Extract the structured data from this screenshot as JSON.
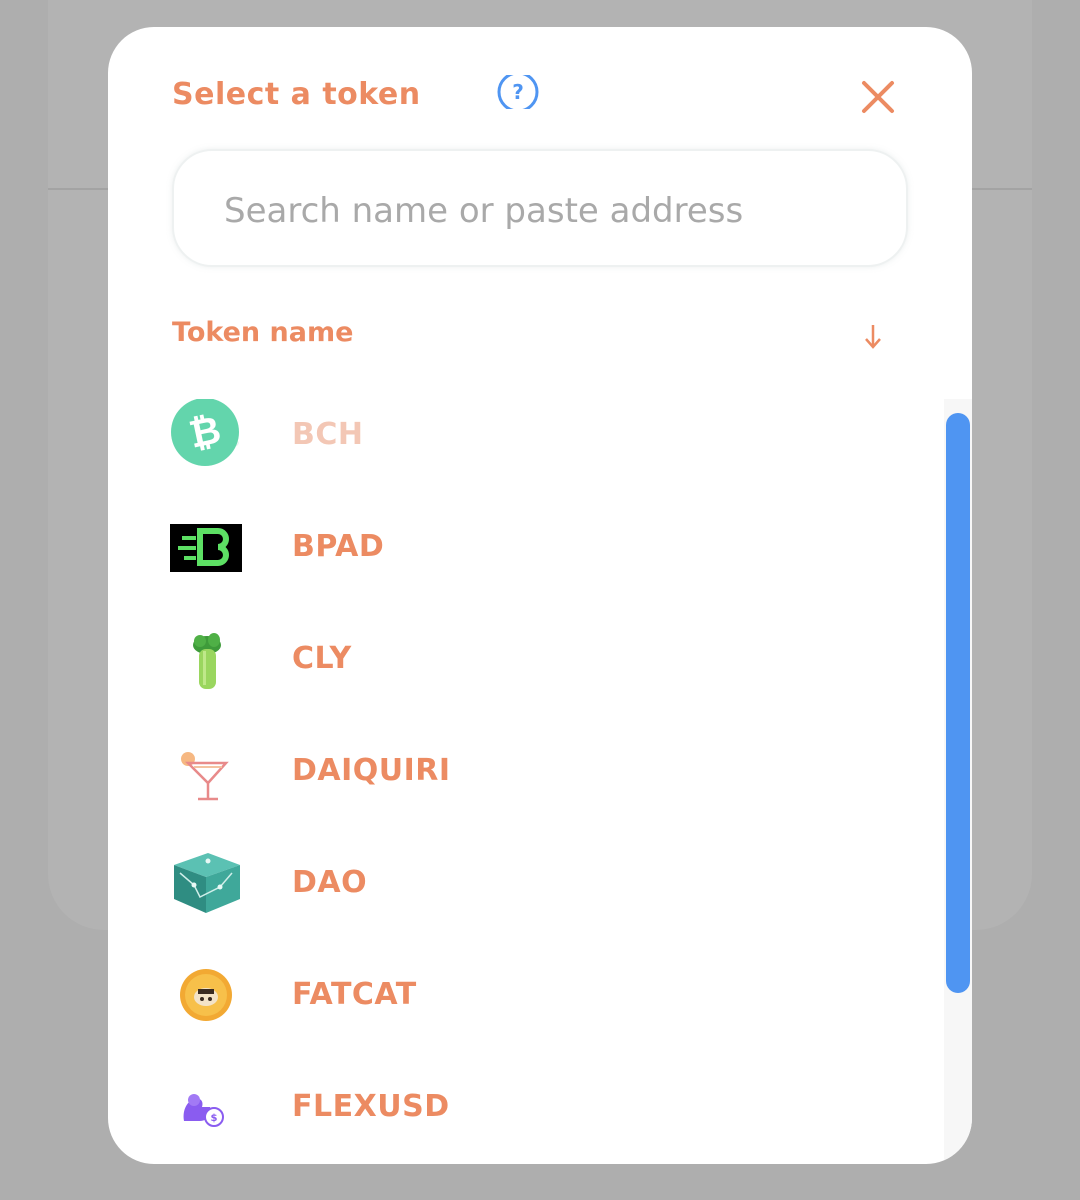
{
  "modal": {
    "title": "Select a token",
    "search_placeholder": "Search name or paste address",
    "list_header": "Token name",
    "accent_color": "#ec8b62",
    "scrollbar_color": "#4f95f2"
  },
  "tokens": [
    {
      "symbol": "BCH",
      "icon": "bitcoin-cash-icon",
      "disabled": true
    },
    {
      "symbol": "BPAD",
      "icon": "bpad-icon",
      "disabled": false
    },
    {
      "symbol": "CLY",
      "icon": "celery-icon",
      "disabled": false
    },
    {
      "symbol": "DAIQUIRI",
      "icon": "cocktail-icon",
      "disabled": false
    },
    {
      "symbol": "DAO",
      "icon": "dao-cube-icon",
      "disabled": false
    },
    {
      "symbol": "FATCAT",
      "icon": "fatcat-coin-icon",
      "disabled": false
    },
    {
      "symbol": "FLEXUSD",
      "icon": "flexusd-icon",
      "disabled": false
    }
  ]
}
